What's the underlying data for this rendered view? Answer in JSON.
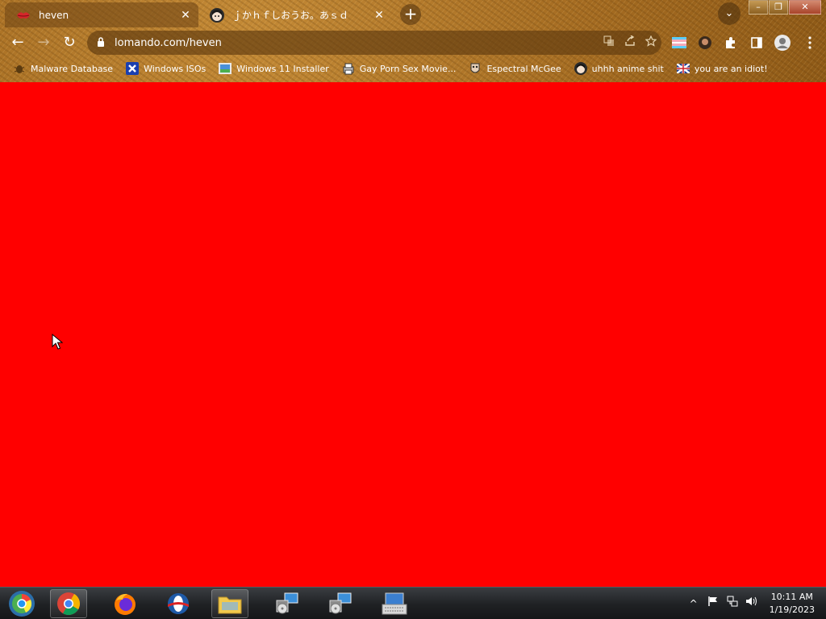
{
  "browser": {
    "tabs": [
      {
        "title": "heven",
        "icon": "lips-icon",
        "active": true
      },
      {
        "title": "ｊかｈｆしおうお。あｓｄ",
        "icon": "anime-face-icon",
        "active": false
      }
    ],
    "close_glyph": "✕",
    "new_tab_glyph": "+",
    "tab_search_glyph": "⌄",
    "window_controls": {
      "minimize": "–",
      "restore": "❐",
      "close": "✕"
    },
    "nav": {
      "back": "←",
      "forward": "→",
      "reload": "↻"
    },
    "address": {
      "lock": "🔒",
      "url": "lomando.com/heven"
    },
    "bookmarks": [
      {
        "label": "Malware Database",
        "icon": "bug-icon"
      },
      {
        "label": "Windows ISOs",
        "icon": "x-logo-icon"
      },
      {
        "label": "Windows 11 Installer",
        "icon": "image-icon"
      },
      {
        "label": "Gay Porn Sex Movie...",
        "icon": "printer-icon"
      },
      {
        "label": "Espectral McGee",
        "icon": "mask-icon"
      },
      {
        "label": "uhhh anime shit",
        "icon": "anime-face-icon"
      },
      {
        "label": "you are an idiot!",
        "icon": "flag-icon"
      }
    ]
  },
  "page": {
    "background": "#ff0000"
  },
  "taskbar": {
    "items": [
      {
        "name": "start-button",
        "icon": "windows-orb-icon"
      },
      {
        "name": "chrome",
        "icon": "chrome-icon"
      },
      {
        "name": "firefox",
        "icon": "firefox-icon"
      },
      {
        "name": "opera",
        "icon": "opera-icon"
      },
      {
        "name": "file-explorer",
        "icon": "folder-icon"
      },
      {
        "name": "setup-1",
        "icon": "installer-icon"
      },
      {
        "name": "setup-2",
        "icon": "installer-icon"
      },
      {
        "name": "on-screen-keyboard",
        "icon": "keyboard-icon"
      }
    ],
    "tray": {
      "show_hidden": "^",
      "flag": "⚑",
      "network": "🖧",
      "volume": "🔊"
    },
    "clock": {
      "time": "10:11 AM",
      "date": "1/19/2023"
    }
  }
}
